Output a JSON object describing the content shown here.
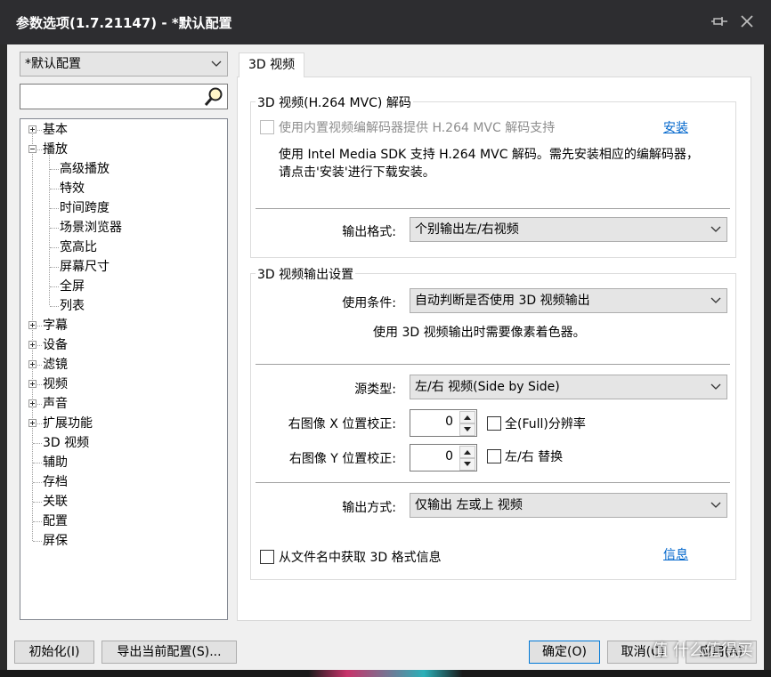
{
  "window": {
    "title": "参数选项(1.7.21147) - *默认配置",
    "pin_icon": "pin-icon",
    "close_icon": "close-icon"
  },
  "left": {
    "profile_select": "*默认配置",
    "search_placeholder": "",
    "tree": [
      {
        "label": "基本",
        "expandable": true,
        "expanded": false
      },
      {
        "label": "播放",
        "expandable": true,
        "expanded": true,
        "children": [
          "高级播放",
          "特效",
          "时间跨度",
          "场景浏览器",
          "宽高比",
          "屏幕尺寸",
          "全屏",
          "列表"
        ]
      },
      {
        "label": "字幕",
        "expandable": true,
        "expanded": false
      },
      {
        "label": "设备",
        "expandable": true,
        "expanded": false
      },
      {
        "label": "滤镜",
        "expandable": true,
        "expanded": false
      },
      {
        "label": "视频",
        "expandable": true,
        "expanded": false
      },
      {
        "label": "声音",
        "expandable": true,
        "expanded": false
      },
      {
        "label": "扩展功能",
        "expandable": true,
        "expanded": false
      },
      {
        "label": "3D 视频",
        "expandable": false,
        "selected": true
      },
      {
        "label": "辅助",
        "expandable": false
      },
      {
        "label": "存档",
        "expandable": false
      },
      {
        "label": "关联",
        "expandable": false
      },
      {
        "label": "配置",
        "expandable": false
      },
      {
        "label": "屏保",
        "expandable": false
      }
    ]
  },
  "tab": {
    "label": "3D 视频"
  },
  "decode_group": {
    "title": "3D 视频(H.264 MVC) 解码",
    "builtin_checkbox_label": "使用内置视频编解码器提供 H.264 MVC 解码支持",
    "builtin_checked": false,
    "builtin_disabled": true,
    "install_link": "安装",
    "info_line1": "使用 Intel Media SDK 支持 H.264 MVC 解码。需先安装相应的编解码器，",
    "info_line2": "请点击'安装'进行下载安装。",
    "output_format_label": "输出格式:",
    "output_format_value": "个别输出左/右视频"
  },
  "output_group": {
    "title": "3D 视频输出设置",
    "condition_label": "使用条件:",
    "condition_value": "自动判断是否使用 3D 视频输出",
    "condition_note": "使用 3D 视频输出时需要像素着色器。",
    "source_type_label": "源类型:",
    "source_type_value": "左/右 视频(Side by Side)",
    "x_offset_label": "右图像 X 位置校正:",
    "x_offset_value": "0",
    "full_res_label": "全(Full)分辨率",
    "full_res_checked": false,
    "y_offset_label": "右图像 Y 位置校正:",
    "y_offset_value": "0",
    "swap_label": "左/右 替换",
    "swap_checked": false,
    "output_mode_label": "输出方式:",
    "output_mode_value": "仅输出 左或上 视频"
  },
  "filename_checkbox_label": "从文件名中获取 3D 格式信息",
  "filename_checked": false,
  "info_link": "信息",
  "buttons": {
    "init": "初始化(I)",
    "export": "导出当前配置(S)...",
    "ok": "确定(O)",
    "cancel": "取消(C)",
    "apply": "应用(A)"
  },
  "watermark": "值 什么值得买",
  "colors": {
    "titlebar": "#2d2d30",
    "client": "#f0f0f0",
    "link": "#0066cc",
    "primary_border": "#0078d7"
  }
}
